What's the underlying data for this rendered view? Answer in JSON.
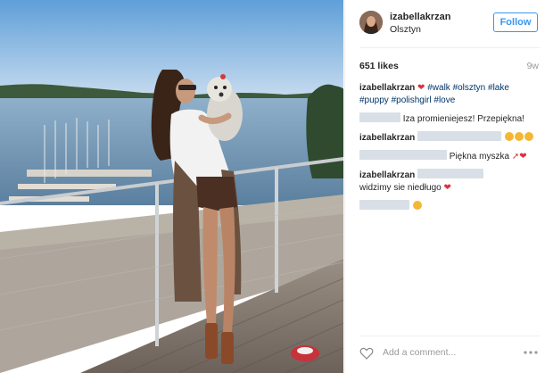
{
  "post": {
    "username": "izabellakrzan",
    "location": "Olsztyn",
    "follow_label": "Follow",
    "likes": "651 likes",
    "time_ago": "9w"
  },
  "caption": {
    "username": "izabellakrzan",
    "hashtags_line1": "#walk #olsztyn #lake",
    "hashtags_line2": "#puppy #polishgirl #love"
  },
  "comments": [
    {
      "username": "",
      "text": "Iza promieniejesz! Przepiękna!"
    },
    {
      "username": "izabellakrzan",
      "text": ""
    },
    {
      "username": "",
      "text": "Piękna myszka"
    },
    {
      "username": "izabellakrzan",
      "text": "widzimy sie niedługo"
    }
  ],
  "footer": {
    "add_comment_placeholder": "Add a comment..."
  },
  "colors": {
    "accent": "#3897f0",
    "heart": "#e0303c",
    "hashtag": "#003569"
  },
  "icons": [
    "heart-icon",
    "more-options-icon",
    "avatar"
  ]
}
